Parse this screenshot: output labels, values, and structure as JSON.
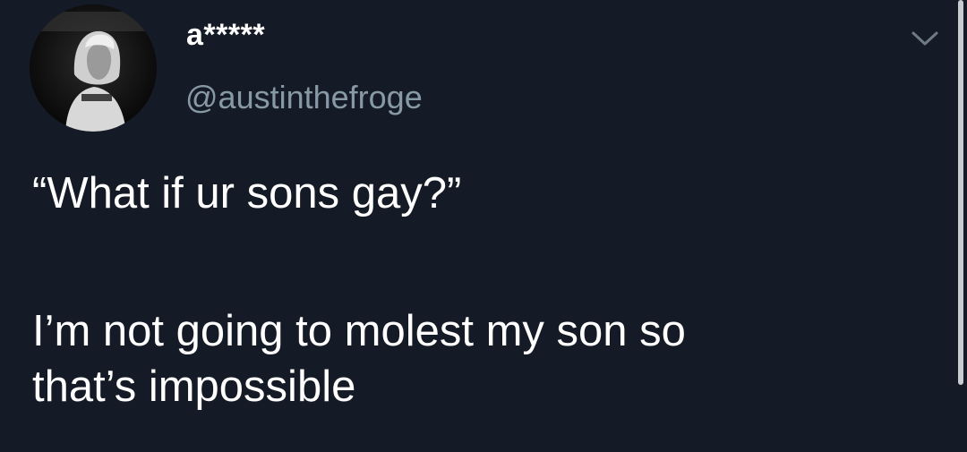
{
  "tweet": {
    "display_name": "a*****",
    "handle": "@austinthefroge",
    "avatar_icon": "user-avatar-icon",
    "menu_icon": "chevron-down-icon",
    "text_lines": [
      "“What if ur sons gay?”",
      "I’m not going to molest my son so",
      "that’s impossible"
    ]
  },
  "colors": {
    "background": "#151b26",
    "text": "#ffffff",
    "handle": "#8899a6"
  }
}
